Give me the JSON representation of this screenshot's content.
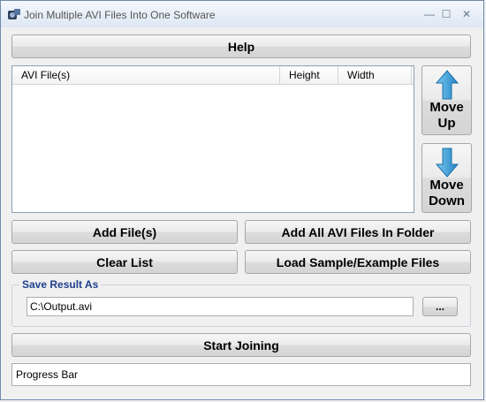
{
  "window": {
    "title": "Join Multiple AVI Files Into One Software",
    "minimize_glyph": "—",
    "maximize_glyph": "☐",
    "close_glyph": "✕"
  },
  "buttons": {
    "help": "Help",
    "add_files": "Add File(s)",
    "add_folder": "Add All AVI Files In Folder",
    "clear_list": "Clear List",
    "load_sample": "Load Sample/Example Files",
    "start": "Start Joining",
    "browse": "...",
    "move_up_line1": "Move",
    "move_up_line2": "Up",
    "move_down_line1": "Move",
    "move_down_line2": "Down"
  },
  "list": {
    "columns": [
      "AVI File(s)",
      "Height",
      "Width"
    ],
    "rows": []
  },
  "save": {
    "group_label": "Save Result As",
    "path": "C:\\Output.avi"
  },
  "progress": {
    "label": "Progress Bar"
  },
  "icons": {
    "app": "app-icon",
    "up_arrow": "arrow-up-icon",
    "down_arrow": "arrow-down-icon"
  },
  "colors": {
    "arrow_blue": "#3aa0d8",
    "group_title": "#1e3f8c"
  }
}
